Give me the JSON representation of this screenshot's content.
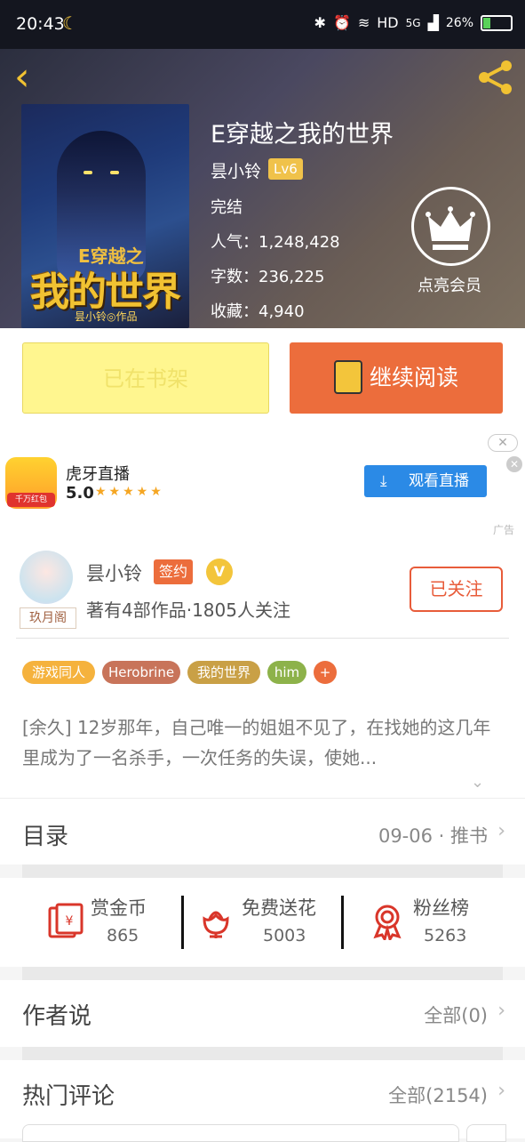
{
  "status_bar": {
    "time": "20:43",
    "network": "HD",
    "signal": "5G",
    "battery": "26%"
  },
  "header": {
    "title": "E穿越之我的世界",
    "author": "昙小铃",
    "level": "Lv6",
    "status": "完结",
    "popularity_label": "人气：",
    "popularity": "1,248,428",
    "words_label": "字数：",
    "words": "236,225",
    "favorites_label": "收藏：",
    "favorites": "4,940",
    "vip_label": "点亮会员",
    "cover": {
      "top_text": "E穿越之",
      "main_text": "我的世界",
      "byline": "昙小铃◎作品"
    }
  },
  "actions": {
    "shelf_label": "已在书架",
    "read_label": "继续阅读"
  },
  "ad": {
    "app_name": "虎牙直播",
    "score": "5.0",
    "stars": "★★★★★",
    "icon_badge": "千万红包",
    "button_label": "观看直播",
    "ad_tag": "广告"
  },
  "author_card": {
    "name": "昙小铃",
    "sign_badge": "签约",
    "v_badge": "V",
    "info": "著有4部作品·1805人关注",
    "avatar_badge": "玖月阁",
    "follow_label": "已关注"
  },
  "tags": [
    {
      "label": "游戏同人",
      "color": "#f5b23d"
    },
    {
      "label": "Herobrine",
      "color": "#c8745a"
    },
    {
      "label": "我的世界",
      "color": "#c9a046"
    },
    {
      "label": "him",
      "color": "#8db24a"
    },
    {
      "label": "+",
      "color": "#ec6d3c"
    }
  ],
  "description": "[余久] 12岁那年，自己唯一的姐姐不见了，在找她的这几年里成为了一名杀手，一次任务的失误，使她...",
  "toc": {
    "title": "目录",
    "latest": "09-06 · 推书"
  },
  "gifts": [
    {
      "name": "赏金币",
      "value": "865",
      "icon": "red-envelope-icon"
    },
    {
      "name": "免费送花",
      "value": "5003",
      "icon": "flower-icon"
    },
    {
      "name": "粉丝榜",
      "value": "5263",
      "icon": "medal-icon"
    }
  ],
  "author_say": {
    "title": "作者说",
    "right": "全部(0)"
  },
  "hot_comments": {
    "title": "热门评论",
    "right": "全部(2154)"
  },
  "colors": {
    "accent": "#ec6d3c",
    "gold": "#f3c53b",
    "shelf_bg": "#fff68f",
    "ad_button": "#2b8ae6"
  }
}
